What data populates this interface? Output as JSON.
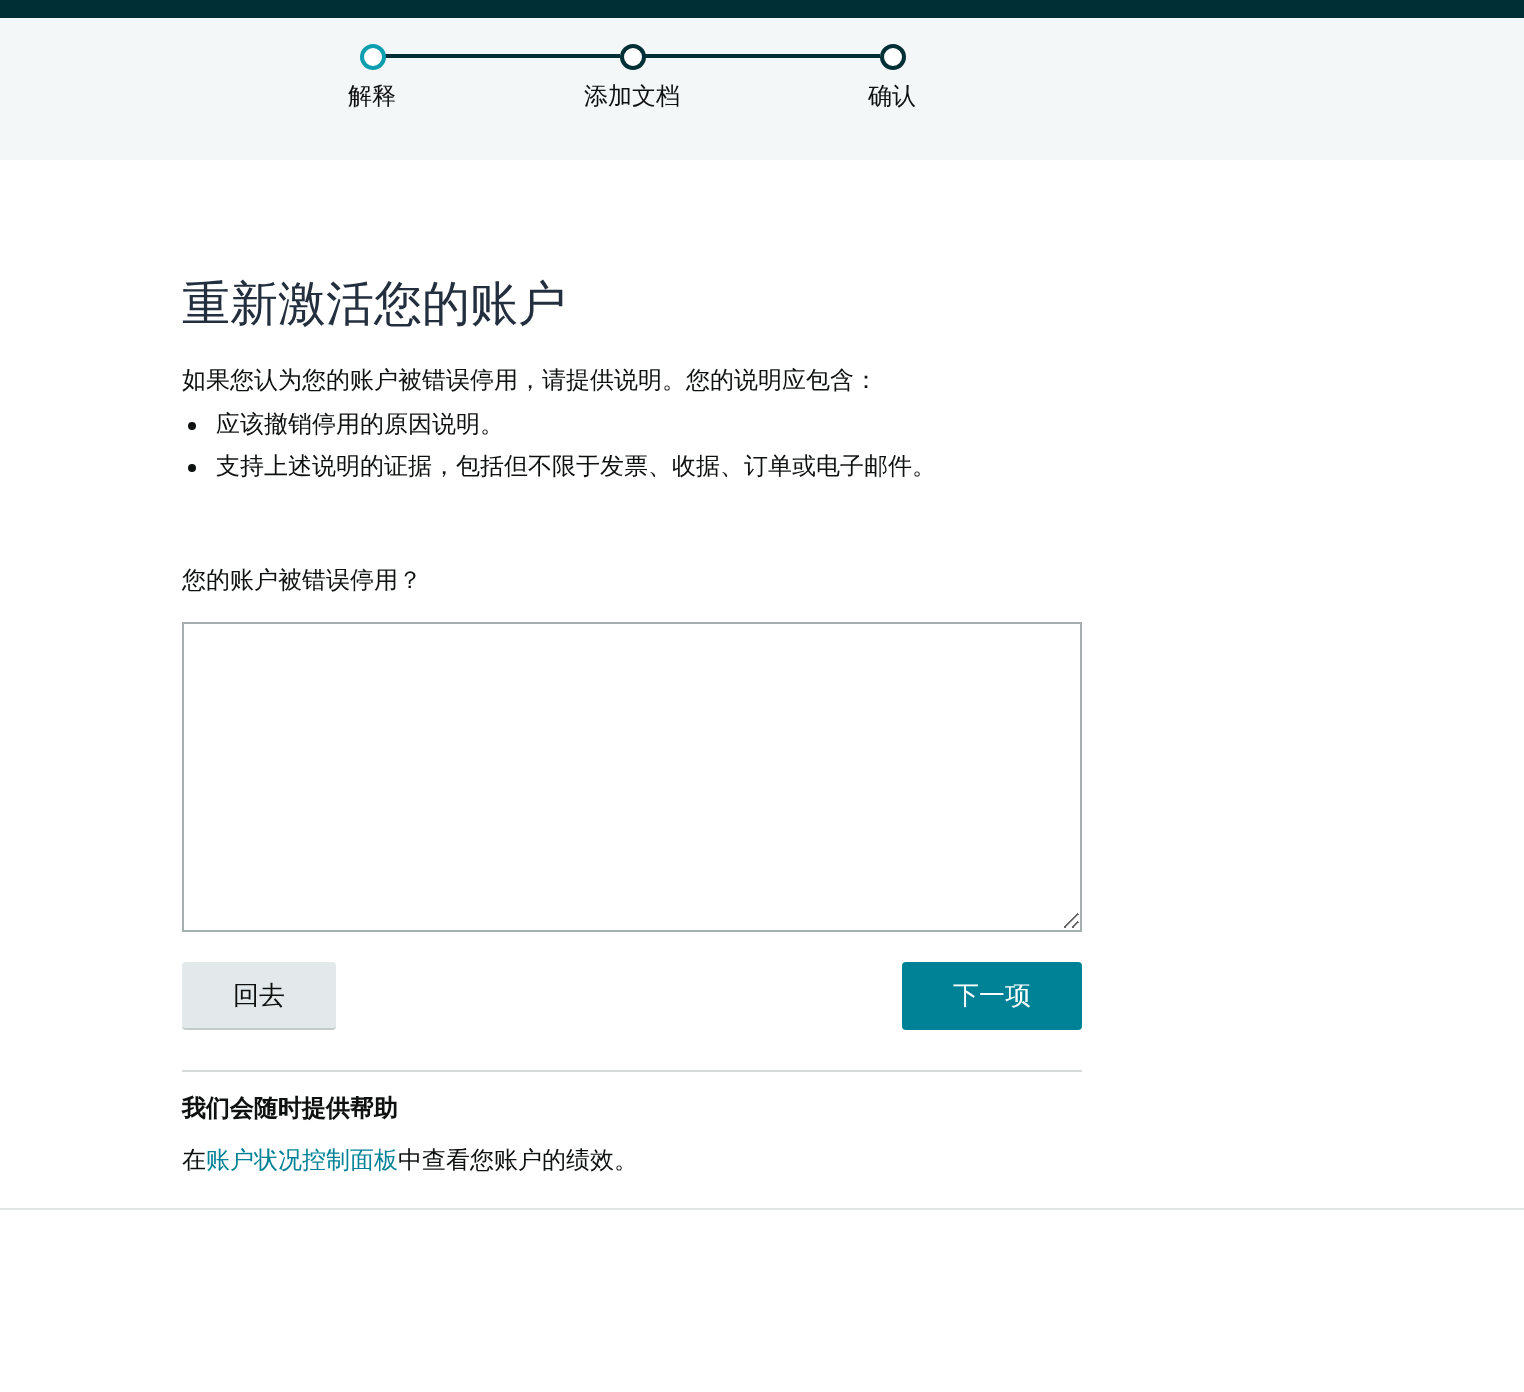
{
  "stepper": [
    {
      "label": "解释",
      "selected": true
    },
    {
      "label": "添加文档",
      "selected": false
    },
    {
      "label": "确认",
      "selected": false
    }
  ],
  "title": "重新激活您的账户",
  "intro": "如果您认为您的账户被错误停用，请提供说明。您的说明应包含：",
  "bullets": [
    "应该撤销停用的原因说明。",
    "支持上述说明的证据，包括但不限于发票、收据、订单或电子邮件。"
  ],
  "question": {
    "label": "您的账户被错误停用？"
  },
  "buttons": {
    "back": "回去",
    "next": "下一项"
  },
  "help": {
    "heading": "我们会随时提供帮助",
    "before": "在",
    "link": "账户状况控制面板",
    "after": "中查看您账户的绩效。"
  }
}
